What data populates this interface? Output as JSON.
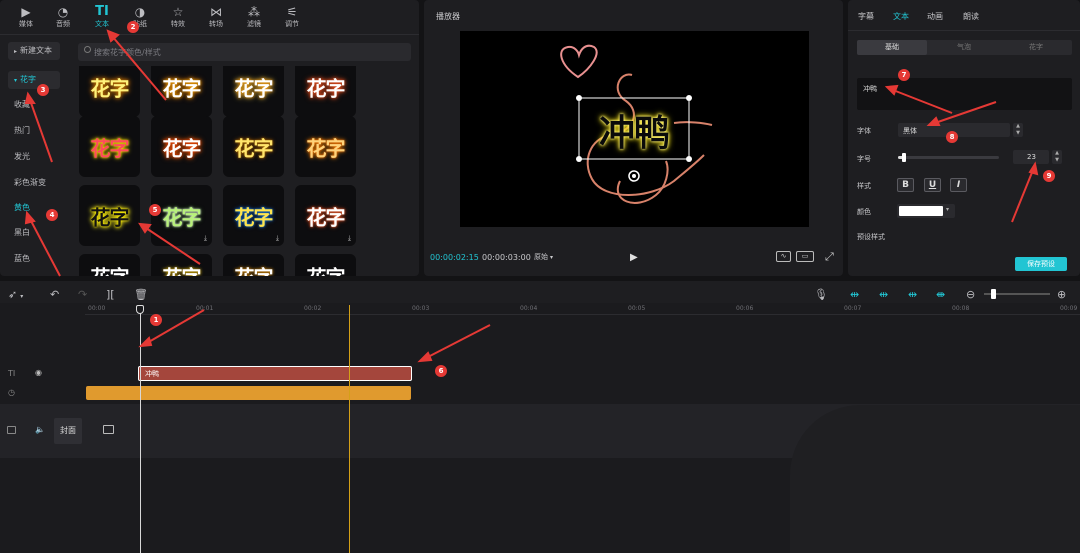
{
  "top_tabs": [
    {
      "label": "媒体",
      "icon": "media-icon"
    },
    {
      "label": "音频",
      "icon": "audio-icon"
    },
    {
      "label": "文本",
      "icon": "text-icon"
    },
    {
      "label": "贴纸",
      "icon": "sticker-icon"
    },
    {
      "label": "特效",
      "icon": "effects-icon"
    },
    {
      "label": "转场",
      "icon": "transition-icon"
    },
    {
      "label": "滤镜",
      "icon": "filter-icon"
    },
    {
      "label": "调节",
      "icon": "adjust-icon"
    }
  ],
  "sidebar": {
    "items": [
      "新建文本",
      "花字",
      "收藏",
      "热门",
      "发光",
      "彩色渐变",
      "黄色",
      "黑白",
      "蓝色"
    ]
  },
  "search": {
    "placeholder": "搜索花字颜色/样式"
  },
  "tile_text": "花字",
  "download_glyph": "⤓",
  "player": {
    "title": "播放器",
    "current_time": "00:00:02:15",
    "total_time": "00:00:03:00",
    "ratio_label": "原始",
    "caption": "冲鸭"
  },
  "inspector": {
    "tabs": [
      "字幕",
      "文本",
      "动画",
      "朗读"
    ],
    "subtabs": [
      "基础",
      "气泡",
      "花字"
    ],
    "text_value": "冲鸭",
    "font_label": "字体",
    "font_value": "黑体",
    "size_label": "字号",
    "size_value": "23",
    "style_label": "样式",
    "style_bold": "B",
    "style_underline": "U",
    "style_italic": "I",
    "color_label": "颜色",
    "preset_label": "预设样式",
    "save_button": "保存预设"
  },
  "timeline": {
    "ticks": [
      "00:00",
      "00:01",
      "00:02",
      "00:03",
      "00:04",
      "00:05",
      "00:06",
      "00:07",
      "00:08",
      "00:09"
    ],
    "text_clip_label": "冲鸭",
    "track_text_icon": "TI",
    "cover_label": "封面"
  },
  "annotations": [
    "1",
    "2",
    "3",
    "4",
    "5",
    "6",
    "7",
    "8",
    "9"
  ],
  "colors": {
    "accent": "#22c5d3",
    "text_clip": "#a4463c",
    "orange_clip": "#e09a2e",
    "annotation": "#e53935",
    "playhead_yellow": "#d4a017"
  }
}
